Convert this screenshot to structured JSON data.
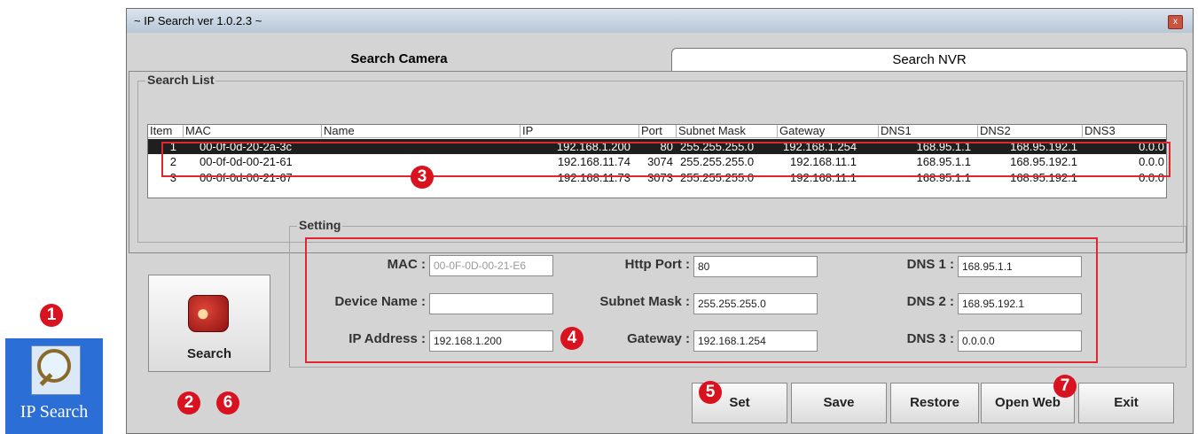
{
  "desktop_icon": {
    "label": "IP Search"
  },
  "window": {
    "title": "~ IP Search ver 1.0.2.3 ~",
    "close": "x"
  },
  "tabs": [
    {
      "label": "Search Camera"
    },
    {
      "label": "Search NVR"
    }
  ],
  "search_list": {
    "label": "Search List",
    "columns": [
      "Item",
      "MAC",
      "Name",
      "IP",
      "Port",
      "Subnet Mask",
      "Gateway",
      "DNS1",
      "DNS2",
      "DNS3"
    ],
    "rows": [
      {
        "item": "1",
        "mac": "00-0f-0d-20-2a-3c",
        "name": "",
        "ip": "192.168.1.200",
        "port": "80",
        "subnet": "255.255.255.0",
        "gateway": "192.168.1.254",
        "dns1": "168.95.1.1",
        "dns2": "168.95.192.1",
        "dns3": "0.0.0"
      },
      {
        "item": "2",
        "mac": "00-0f-0d-00-21-61",
        "name": "",
        "ip": "192.168.11.74",
        "port": "3074",
        "subnet": "255.255.255.0",
        "gateway": "192.168.11.1",
        "dns1": "168.95.1.1",
        "dns2": "168.95.192.1",
        "dns3": "0.0.0"
      },
      {
        "item": "3",
        "mac": "00-0f-0d-00-21-67",
        "name": "",
        "ip": "192.168.11.73",
        "port": "3073",
        "subnet": "255.255.255.0",
        "gateway": "192.168.11.1",
        "dns1": "168.95.1.1",
        "dns2": "168.95.192.1",
        "dns3": "0.0.0"
      }
    ]
  },
  "setting": {
    "label": "Setting",
    "mac": {
      "label": "MAC :",
      "value": "00-0F-0D-00-21-E6"
    },
    "device_name": {
      "label": "Device Name :",
      "value": ""
    },
    "ip_address": {
      "label": "IP Address :",
      "value": "192.168.1.200"
    },
    "http_port": {
      "label": "Http Port :",
      "value": "80"
    },
    "subnet_mask": {
      "label": "Subnet Mask :",
      "value": "255.255.255.0"
    },
    "gateway": {
      "label": "Gateway :",
      "value": "192.168.1.254"
    },
    "dns1": {
      "label": "DNS 1 :",
      "value": "168.95.1.1"
    },
    "dns2": {
      "label": "DNS 2 :",
      "value": "168.95.192.1"
    },
    "dns3": {
      "label": "DNS 3 :",
      "value": "0.0.0.0"
    }
  },
  "buttons": {
    "search": "Search",
    "set": "Set",
    "save": "Save",
    "restore": "Restore",
    "open_web": "Open Web",
    "exit": "Exit"
  },
  "annotations": [
    "1",
    "2",
    "3",
    "4",
    "5",
    "6",
    "7"
  ],
  "colors": {
    "highlight": "#e0262f",
    "badge": "#d8121e",
    "selected_row": "#1f1f1f",
    "desktop": "#2b6fd6"
  }
}
